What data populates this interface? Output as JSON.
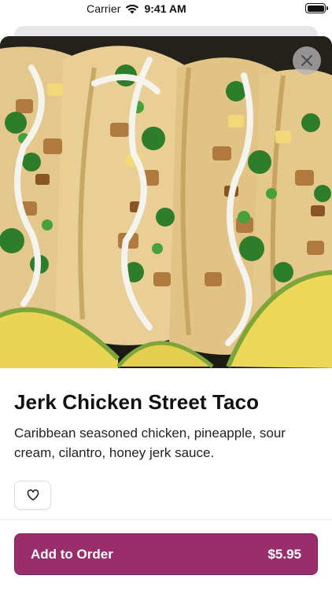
{
  "status_bar": {
    "carrier": "Carrier",
    "time": "9:41 AM"
  },
  "item": {
    "title": "Jerk Chicken Street Taco",
    "description": "Caribbean seasoned chicken, pineapple, sour cream, cilantro, honey jerk sauce.",
    "image_icon": "food-photo"
  },
  "actions": {
    "close_icon": "close-icon",
    "favorite_icon": "heart-icon"
  },
  "order_button": {
    "label": "Add to Order",
    "price": "$5.95"
  },
  "colors": {
    "accent": "#9a2d6c",
    "text": "#111111"
  }
}
